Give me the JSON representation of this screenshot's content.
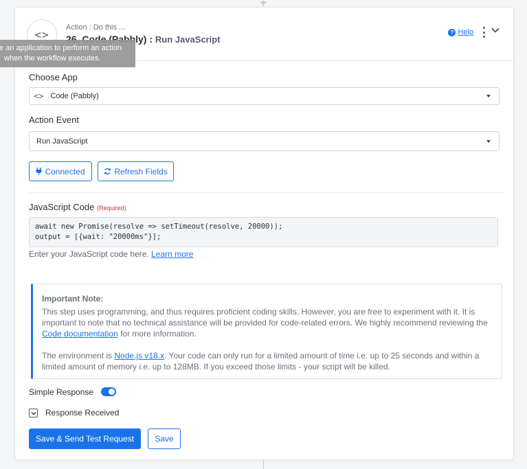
{
  "header": {
    "action_label": "Action : Do this ...",
    "step_title": "26. Code (Pabbly) :",
    "step_event": "Run JavaScript",
    "help_label": "Help",
    "app_icon_glyph": "<>"
  },
  "tooltip": {
    "line1": "e an application to perform an action",
    "line2": "when the workflow executes."
  },
  "choose_app": {
    "label": "Choose App",
    "value": "Code (Pabbly)",
    "icon_glyph": "<>"
  },
  "action_event": {
    "label": "Action Event",
    "value": "Run JavaScript"
  },
  "buttons": {
    "connected": "Connected",
    "refresh": "Refresh Fields",
    "send_test": "Save & Send Test Request",
    "save": "Save"
  },
  "code": {
    "label": "JavaScript Code",
    "required": "(Required)",
    "line1": "await new Promise(resolve => setTimeout(resolve, 20000));",
    "line2": "output = [{wait: \"20000ms\"}];",
    "hint": "Enter your JavaScript code here.",
    "learn_more": "Learn more"
  },
  "note": {
    "title": "Important Note:",
    "p1_text": "This step uses programming, and thus requires proficient coding skills. However, you are free to experiment with it. It is important to note that no technical assistance will be provided for code-related errors. We highly recommend reviewing the",
    "p1_link": "Code documentation",
    "p1_tail": "for more information.",
    "p2_lead": "The environment is",
    "p2_link": "Node.js v18.x",
    "p2_text": ". Your code can only run for a limited amount of time i.e. up to 25 seconds and within a limited amount of memory i.e. up to 128MB. If you exceed those limits - your script will be killed."
  },
  "simple_response": {
    "label": "Simple Response",
    "enabled": true
  },
  "response_received": {
    "label": "Response Received"
  },
  "colors": {
    "accent": "#1a73e8",
    "required": "#d93025"
  }
}
